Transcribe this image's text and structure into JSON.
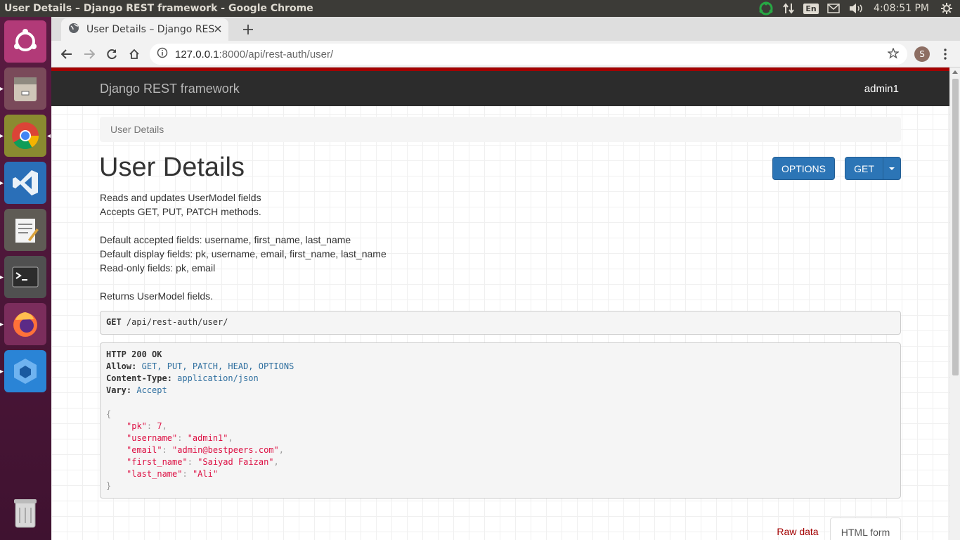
{
  "os": {
    "window_title": "User Details – Django REST framework - Google Chrome",
    "tray": {
      "lang": "En",
      "clock": "4:08:51 PM"
    }
  },
  "launcher": {
    "items": [
      "ubuntu-dash",
      "files",
      "google-chrome",
      "vs-code",
      "text-editor",
      "terminal",
      "firefox",
      "app",
      "trash"
    ]
  },
  "browser": {
    "tab_title": "User Details – Django REST framework",
    "url_host": "127.0.0.1",
    "url_path": ":8000/api/rest-auth/user/",
    "profile_initial": "S"
  },
  "page": {
    "brand": "Django REST framework",
    "user": "admin1",
    "breadcrumb": "User Details",
    "title": "User Details",
    "options_label": "OPTIONS",
    "get_label": "GET",
    "description": {
      "line1": "Reads and updates UserModel fields",
      "line2": "Accepts GET, PUT, PATCH methods.",
      "line3": "Default accepted fields: username, first_name, last_name",
      "line4": "Default display fields: pk, username, email, first_name, last_name",
      "line5": "Read-only fields: pk, email",
      "line6": "Returns UserModel fields."
    },
    "request": {
      "method": "GET",
      "path": "/api/rest-auth/user/"
    },
    "response": {
      "status": "HTTP 200 OK",
      "allow_key": "Allow:",
      "allow_val": "GET, PUT, PATCH, HEAD, OPTIONS",
      "ctype_key": "Content-Type:",
      "ctype_val": "application/json",
      "vary_key": "Vary:",
      "vary_val": "Accept",
      "body": {
        "pk_key": "\"pk\"",
        "pk_val": "7",
        "username_key": "\"username\"",
        "username_val": "\"admin1\"",
        "email_key": "\"email\"",
        "email_val": "\"admin@bestpeers.com\"",
        "first_name_key": "\"first_name\"",
        "first_name_val": "\"Saiyad Faizan\"",
        "last_name_key": "\"last_name\"",
        "last_name_val": "\"Ali\""
      }
    },
    "form_tabs": {
      "raw": "Raw data",
      "html": "HTML form"
    }
  }
}
